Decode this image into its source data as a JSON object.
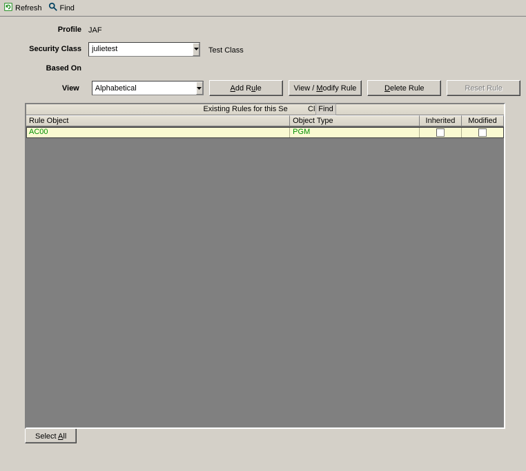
{
  "toolbar": {
    "refresh_label": "Refresh",
    "find_label": "Find"
  },
  "form": {
    "profile_label": "Profile",
    "profile_value": "JAF",
    "security_class_label": "Security Class",
    "security_class_value": "julietest",
    "security_class_extra": "Test Class",
    "based_on_label": "Based On",
    "based_on_value": "",
    "view_label": "View",
    "view_value": "Alphabetical"
  },
  "actions": {
    "add_rule": "Add Rule",
    "view_modify_rule_prefix": "View / ",
    "view_modify_rule_key": "M",
    "view_modify_rule_suffix": "odify Rule",
    "delete_rule": "Delete Rule",
    "reset_rule": "Reset Rule"
  },
  "table": {
    "title_prefix": "Existing Rules for this Se",
    "title_suffix": " Class",
    "find_text": "Find",
    "headers": {
      "rule_object": "Rule Object",
      "object_type": "Object Type",
      "inherited": "Inherited",
      "modified": "Modified"
    },
    "rows": [
      {
        "rule_object": "AC00",
        "object_type": "PGM",
        "inherited": false,
        "modified": false
      }
    ]
  },
  "tabs": {
    "select_all_prefix": "Select ",
    "select_all_key": "A",
    "select_all_suffix": "ll"
  }
}
